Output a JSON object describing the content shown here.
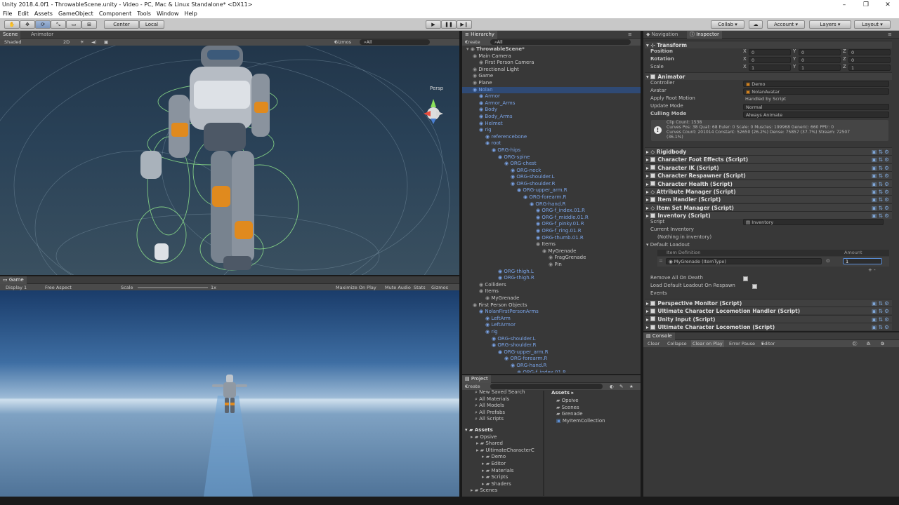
{
  "window": {
    "title": "Unity 2018.4.0f1 - ThrowableScene.unity - Video - PC, Mac & Linux Standalone* <DX11>",
    "min": "–",
    "max": "❐",
    "close": "✕"
  },
  "menu": [
    "File",
    "Edit",
    "Assets",
    "GameObject",
    "Component",
    "Tools",
    "Window",
    "Help"
  ],
  "toolbar": {
    "pivot": "Center",
    "space": "Local",
    "collab": "Collab",
    "account": "Account",
    "layers": "Layers",
    "layout": "Layout"
  },
  "scene": {
    "tabs": [
      "Scene",
      "Animator"
    ],
    "shading": "Shaded",
    "mode2d": "2D",
    "gizmos": "Gizmos",
    "all": "All",
    "persp": "Persp"
  },
  "game": {
    "tab": "Game",
    "display": "Display 1",
    "aspect": "Free Aspect",
    "scale_label": "Scale",
    "scale_value": "1x",
    "maximize": "Maximize On Play",
    "mute": "Mute Audio",
    "stats": "Stats",
    "gizmos": "Gizmos"
  },
  "hierarchy": {
    "tab": "Hierarchy",
    "create": "Create",
    "search": "All",
    "items": [
      {
        "label": "ThrowableScene*",
        "indent": 0,
        "bold": true
      },
      {
        "label": "Main Camera",
        "indent": 1
      },
      {
        "label": "First Person Camera",
        "indent": 2
      },
      {
        "label": "Directional Light",
        "indent": 1
      },
      {
        "label": "Game",
        "indent": 1
      },
      {
        "label": "Plane",
        "indent": 1
      },
      {
        "label": "Nolan",
        "indent": 1,
        "blue": true,
        "selected": true
      },
      {
        "label": "Armor",
        "indent": 2,
        "blue": true
      },
      {
        "label": "Armor_Arms",
        "indent": 2,
        "blue": true
      },
      {
        "label": "Body",
        "indent": 2,
        "blue": true
      },
      {
        "label": "Body_Arms",
        "indent": 2,
        "blue": true
      },
      {
        "label": "Helmet",
        "indent": 2,
        "blue": true
      },
      {
        "label": "rig",
        "indent": 2,
        "blue": true
      },
      {
        "label": "referencebone",
        "indent": 3,
        "blue": true
      },
      {
        "label": "root",
        "indent": 3,
        "blue": true
      },
      {
        "label": "ORG-hips",
        "indent": 4,
        "blue": true
      },
      {
        "label": "ORG-spine",
        "indent": 5,
        "blue": true
      },
      {
        "label": "ORG-chest",
        "indent": 6,
        "blue": true
      },
      {
        "label": "ORG-neck",
        "indent": 7,
        "blue": true
      },
      {
        "label": "ORG-shoulder.L",
        "indent": 7,
        "blue": true
      },
      {
        "label": "ORG-shoulder.R",
        "indent": 7,
        "blue": true
      },
      {
        "label": "ORG-upper_arm.R",
        "indent": 8,
        "blue": true
      },
      {
        "label": "ORG-forearm.R",
        "indent": 9,
        "blue": true
      },
      {
        "label": "ORG-hand.R",
        "indent": 10,
        "blue": true
      },
      {
        "label": "ORG-f_index.01.R",
        "indent": 11,
        "blue": true
      },
      {
        "label": "ORG-f_middle.01.R",
        "indent": 11,
        "blue": true
      },
      {
        "label": "ORG-f_pinky.01.R",
        "indent": 11,
        "blue": true
      },
      {
        "label": "ORG-f_ring.01.R",
        "indent": 11,
        "blue": true
      },
      {
        "label": "ORG-thumb.01.R",
        "indent": 11,
        "blue": true
      },
      {
        "label": "Items",
        "indent": 11
      },
      {
        "label": "MyGrenade",
        "indent": 12
      },
      {
        "label": "FragGrenade",
        "indent": 13
      },
      {
        "label": "Pin",
        "indent": 13
      },
      {
        "label": "ORG-thigh.L",
        "indent": 5,
        "blue": true
      },
      {
        "label": "ORG-thigh.R",
        "indent": 5,
        "blue": true
      },
      {
        "label": "Colliders",
        "indent": 2
      },
      {
        "label": "Items",
        "indent": 2
      },
      {
        "label": "MyGrenade",
        "indent": 3
      },
      {
        "label": "First Person Objects",
        "indent": 1
      },
      {
        "label": "NolanFirstPersonArms",
        "indent": 2,
        "blue": true
      },
      {
        "label": "LeftArm",
        "indent": 3,
        "blue": true
      },
      {
        "label": "LeftArmor",
        "indent": 3,
        "blue": true
      },
      {
        "label": "rig",
        "indent": 3,
        "blue": true
      },
      {
        "label": "ORG-shoulder.L",
        "indent": 4,
        "blue": true
      },
      {
        "label": "ORG-shoulder.R",
        "indent": 4,
        "blue": true
      },
      {
        "label": "ORG-upper_arm.R",
        "indent": 5,
        "blue": true
      },
      {
        "label": "ORG-forearm.R",
        "indent": 6,
        "blue": true
      },
      {
        "label": "ORG-hand.R",
        "indent": 7,
        "blue": true
      },
      {
        "label": "ORG-f_index.01.R",
        "indent": 8,
        "blue": true
      }
    ]
  },
  "project": {
    "tab": "Project",
    "create": "Create",
    "favorites": [
      "New Saved Search",
      "All Materials",
      "All Models",
      "All Prefabs",
      "All Scripts"
    ],
    "tree_root": "Assets",
    "tree": [
      {
        "label": "Opsive",
        "indent": 1
      },
      {
        "label": "Shared",
        "indent": 2
      },
      {
        "label": "UltimateCharacterC",
        "indent": 2
      },
      {
        "label": "Demo",
        "indent": 3
      },
      {
        "label": "Editor",
        "indent": 3
      },
      {
        "label": "Materials",
        "indent": 3
      },
      {
        "label": "Scripts",
        "indent": 3
      },
      {
        "label": "Shaders",
        "indent": 3
      },
      {
        "label": "Scenes",
        "indent": 1
      }
    ],
    "breadcrumb": "Assets",
    "assets": [
      "Opsive",
      "Scenes",
      "Grenade",
      "MyItemCollection"
    ]
  },
  "inspector": {
    "tabs": [
      "Navigation",
      "Inspector"
    ],
    "transform": {
      "title": "Transform",
      "rows": [
        {
          "label": "Position",
          "x": "0",
          "y": "0",
          "z": "0"
        },
        {
          "label": "Rotation",
          "x": "0",
          "y": "0",
          "z": "0"
        },
        {
          "label": "Scale",
          "x": "1",
          "y": "1",
          "z": "1"
        }
      ]
    },
    "animator": {
      "title": "Animator",
      "fields": [
        {
          "label": "Controller",
          "value": "Demo"
        },
        {
          "label": "Avatar",
          "value": "NolanAvatar"
        },
        {
          "label": "Apply Root Motion",
          "value": "Handled by Script"
        },
        {
          "label": "Update Mode",
          "value": "Normal"
        },
        {
          "label": "Culling Mode",
          "value": "Always Animate"
        }
      ],
      "info": [
        "Clip Count: 1538",
        "Curves Pos: 38 Quat: 68 Euler: 0 Scale: 0 Muscles: 199968 Generic: 660 PPtr: 0",
        "Curves Count: 201014 Constant: 52650 (26.2%) Dense: 75857 (37.7%) Stream: 72507",
        "(36.1%)"
      ]
    },
    "components": [
      "Rigidbody",
      "Character Foot Effects (Script)",
      "Character IK (Script)",
      "Character Respawner (Script)",
      "Character Health (Script)",
      "Attribute Manager (Script)",
      "Item Handler (Script)",
      "Item Set Manager (Script)",
      "Inventory (Script)"
    ],
    "inventory": {
      "script_label": "Script",
      "script_value": "Inventory",
      "current": "Current Inventory",
      "nothing": "(Nothing in inventory)",
      "default_loadout": "Default Loadout",
      "col_item": "Item Definition",
      "col_amount": "Amount",
      "item": "MyGrenade (ItemType)",
      "amount": "1",
      "remove_on_death": "Remove All On Death",
      "load_on_respawn": "Load Default Loadout On Respawn",
      "events": "Events"
    },
    "components_after": [
      "Perspective Monitor (Script)",
      "Ultimate Character Locomotion Handler (Script)",
      "Unity Input (Script)",
      "Ultimate Character Locomotion (Script)"
    ]
  },
  "console": {
    "tab": "Console",
    "buttons": [
      "Clear",
      "Collapse",
      "Clear on Play",
      "Error Pause",
      "Editor"
    ],
    "counts": [
      "0",
      "0",
      "0"
    ]
  }
}
